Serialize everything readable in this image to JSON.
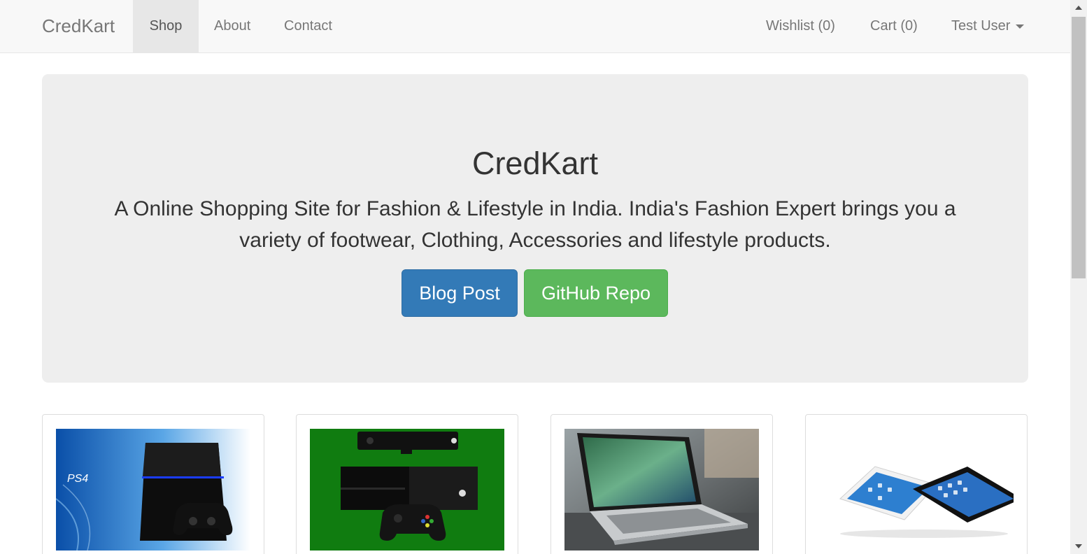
{
  "navbar": {
    "brand": "CredKart",
    "items": [
      {
        "label": "Shop"
      },
      {
        "label": "About"
      },
      {
        "label": "Contact"
      }
    ],
    "right": {
      "wishlist": "Wishlist (0)",
      "cart": "Cart (0)",
      "user": "Test User"
    }
  },
  "jumbotron": {
    "title": "CredKart",
    "text": "A Online Shopping Site for Fashion & Lifestyle in India. India's Fashion Expert brings you a variety of footwear, Clothing, Accessories and lifestyle products.",
    "buttons": {
      "blog": "Blog Post",
      "github": "GitHub Repo"
    }
  },
  "products": [
    {
      "image": "ps4-console-image",
      "logo_text": "PS4"
    },
    {
      "image": "xbox-one-console-image"
    },
    {
      "image": "macbook-laptop-image"
    },
    {
      "image": "ipad-tablets-image"
    }
  ],
  "colors": {
    "primary": "#337ab7",
    "success": "#5cb85c",
    "jumbotron_bg": "#eeeeee",
    "navbar_bg": "#f8f8f8"
  }
}
